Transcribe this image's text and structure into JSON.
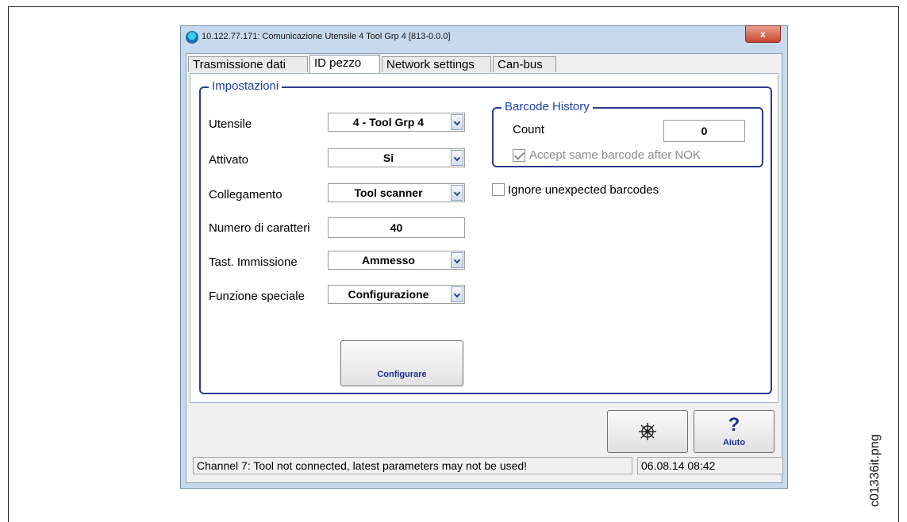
{
  "window": {
    "title": "10.122.77.171: Comunicazione  Utensile 4  Tool Grp 4 [813-0.0.0]",
    "close_label": "x"
  },
  "tabs": [
    {
      "label": "Trasmissione dati",
      "active": false
    },
    {
      "label": "ID pezzo",
      "active": true
    },
    {
      "label": "Network settings",
      "active": false
    },
    {
      "label": "Can-bus",
      "active": false
    }
  ],
  "impostazioni": {
    "title": "Impostazioni",
    "utensile": {
      "label": "Utensile",
      "value": "4 - Tool Grp 4"
    },
    "attivato": {
      "label": "Attivato",
      "value": "Si"
    },
    "collegamento": {
      "label": "Collegamento",
      "value": "Tool scanner"
    },
    "numero": {
      "label": "Numero di caratteri",
      "value": "40"
    },
    "tastiera": {
      "label": "Tast. Immissione",
      "value": "Ammesso"
    },
    "funzione": {
      "label": "Funzione speciale",
      "value": "Configurazione"
    },
    "configure_button": "Configurare"
  },
  "barcode_history": {
    "title": "Barcode History",
    "count_label": "Count",
    "count_value": "0",
    "accept_label": "Accept same barcode after NOK",
    "accept_checked": true
  },
  "ignore_unexpected": {
    "label": "Ignore unexpected barcodes",
    "checked": false
  },
  "toolbar": {
    "help_glyph": "?",
    "help_label": "Aiuto",
    "settings_icon": "ship-wheel-icon"
  },
  "status": {
    "message": "Channel 7: Tool not connected, latest parameters may not be used!",
    "datetime": "06.08.14 08:42"
  },
  "page_label": "c01336it.png"
}
